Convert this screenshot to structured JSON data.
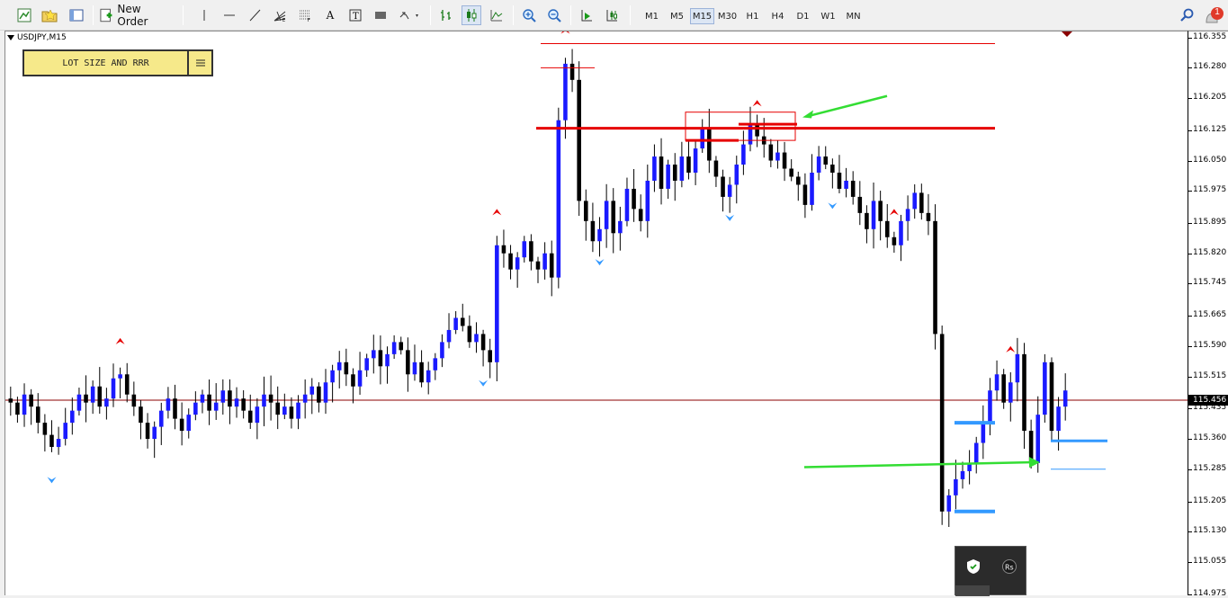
{
  "toolbar": {
    "new_order_label": "New Order",
    "timeframes": [
      "M1",
      "M5",
      "M15",
      "M30",
      "H1",
      "H4",
      "D1",
      "W1",
      "MN"
    ],
    "active_timeframe": "M15",
    "notification_count": "1"
  },
  "chart": {
    "symbol": "USDJPY,M15",
    "panel_button_label": "LOT SIZE AND RRR",
    "current_price_label": "115.456",
    "price_labels": [
      "116.355",
      "116.280",
      "116.205",
      "116.125",
      "116.050",
      "115.975",
      "115.895",
      "115.820",
      "115.745",
      "115.665",
      "115.590",
      "115.515",
      "115.435",
      "115.360",
      "115.285",
      "115.205",
      "115.130",
      "115.055",
      "114.975"
    ]
  },
  "chart_data": {
    "type": "candlestick",
    "symbol": "USDJPY",
    "timeframe": "M15",
    "ylim": [
      114.97,
      116.37
    ],
    "current_price": 115.456,
    "candles_close": [
      115.45,
      115.42,
      115.47,
      115.44,
      115.4,
      115.37,
      115.34,
      115.36,
      115.4,
      115.43,
      115.47,
      115.45,
      115.49,
      115.44,
      115.46,
      115.51,
      115.52,
      115.47,
      115.44,
      115.4,
      115.36,
      115.39,
      115.43,
      115.46,
      115.41,
      115.38,
      115.42,
      115.45,
      115.47,
      115.43,
      115.45,
      115.48,
      115.44,
      115.46,
      115.43,
      115.4,
      115.44,
      115.47,
      115.45,
      115.42,
      115.44,
      115.41,
      115.45,
      115.47,
      115.49,
      115.45,
      115.5,
      115.53,
      115.55,
      115.52,
      115.49,
      115.53,
      115.56,
      115.58,
      115.54,
      115.57,
      115.6,
      115.58,
      115.52,
      115.55,
      115.5,
      115.53,
      115.56,
      115.6,
      115.63,
      115.66,
      115.64,
      115.6,
      115.62,
      115.58,
      115.55,
      115.84,
      115.82,
      115.78,
      115.81,
      115.85,
      115.8,
      115.78,
      115.82,
      115.76,
      116.15,
      116.29,
      116.25,
      115.95,
      115.9,
      115.85,
      115.88,
      115.95,
      115.87,
      115.9,
      115.98,
      115.93,
      115.9,
      116.0,
      116.06,
      115.98,
      116.04,
      116.0,
      116.06,
      116.02,
      116.08,
      116.13,
      116.05,
      116.01,
      115.96,
      115.99,
      116.04,
      116.09,
      116.14,
      116.11,
      116.09,
      116.05,
      116.07,
      116.03,
      116.01,
      115.99,
      115.94,
      116.02,
      116.06,
      116.04,
      116.02,
      115.98,
      116.0,
      115.96,
      115.92,
      115.88,
      115.95,
      115.9,
      115.86,
      115.84,
      115.9,
      115.93,
      115.97,
      115.92,
      115.9,
      115.62,
      115.18,
      115.22,
      115.26,
      115.28,
      115.3,
      115.35,
      115.4,
      115.48,
      115.52,
      115.45,
      115.5,
      115.57,
      115.38,
      115.3,
      115.42,
      115.55,
      115.38,
      115.44,
      115.48
    ]
  },
  "colors": {
    "bull_candle": "#1a1aff",
    "bear_candle": "#000000",
    "resistance_line": "#e60000",
    "support_zone": "#3399ff",
    "annotation_arrow": "#33dd33",
    "fractal_up": "#e60000",
    "fractal_down": "#3399ff",
    "current_price_line": "#8b0000",
    "lot_panel_bg": "#f6e98a"
  },
  "icons": {
    "toolbar_left": [
      "new-chart-icon",
      "profiles-icon",
      "market-watch-icon"
    ],
    "draw_tools": [
      "vertical-line-icon",
      "horizontal-line-icon",
      "trendline-icon",
      "gann-fan-icon",
      "fibonacci-icon",
      "text-icon",
      "text-label-icon",
      "rectangle-icon",
      "arrows-icon"
    ],
    "zoom": [
      "zoom-in-icon",
      "zoom-out-icon"
    ],
    "chart_type": [
      "bar-chart-icon",
      "candle-chart-icon",
      "line-chart-icon"
    ],
    "right": [
      "search-icon",
      "notification-icon"
    ],
    "popup": [
      "shield-icon",
      "rsi-icon"
    ]
  }
}
